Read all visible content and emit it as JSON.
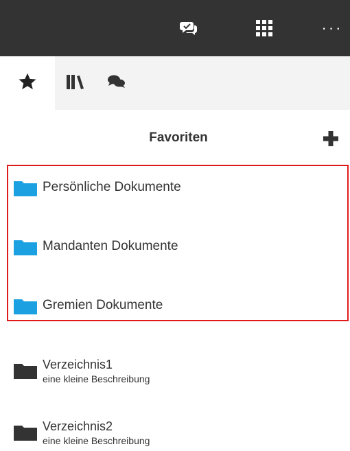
{
  "topbar": {
    "more_label": "···"
  },
  "header": {
    "title": "Favoriten"
  },
  "favorites": [
    {
      "label": "Persönliche Dokumente"
    },
    {
      "label": "Mandanten Dokumente"
    },
    {
      "label": "Gremien Dokumente"
    }
  ],
  "directories": [
    {
      "name": "Verzeichnis1",
      "description": "eine kleine Beschreibung"
    },
    {
      "name": "Verzeichnis2",
      "description": "eine kleine Beschreibung"
    }
  ],
  "colors": {
    "topbar": "#333333",
    "highlight_border": "#e01a1a",
    "folder_blue": "#1ba1e2",
    "folder_dark": "#333333"
  }
}
